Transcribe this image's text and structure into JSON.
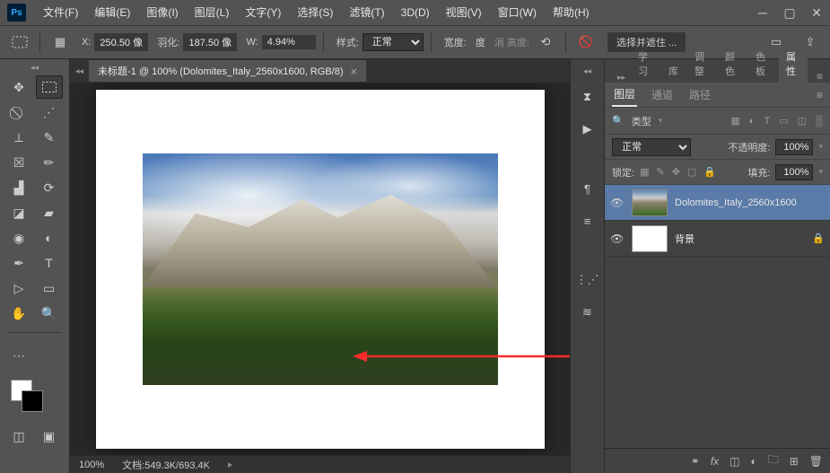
{
  "app": {
    "logo": "Ps"
  },
  "menu": [
    "文件(F)",
    "编辑(E)",
    "图像(I)",
    "图层(L)",
    "文字(Y)",
    "选择(S)",
    "滤镜(T)",
    "3D(D)",
    "视图(V)",
    "窗口(W)",
    "帮助(H)"
  ],
  "options": {
    "x_label": "X:",
    "x_value": "250.50 像",
    "feather_label": "羽化:",
    "feather_value": "187.50 像",
    "w_label": "W:",
    "w_value": "4.94%",
    "style_label": "样式:",
    "style_value": "正常",
    "width_label": "宽度:",
    "height_label": "度",
    "antialias_label": "消 高度:",
    "mask_btn": "选择并遮住 ..."
  },
  "doc": {
    "tab_title": "未标题-1 @ 100% (Dolomites_Italy_2560x1600, RGB/8)",
    "zoom": "100%",
    "status": "文档:549.3K/693.4K"
  },
  "right": {
    "top_tabs": [
      "学习",
      "库",
      "调整",
      "颜色",
      "色板",
      "属性"
    ],
    "sub_tabs": [
      "图层",
      "通道",
      "路径"
    ],
    "filter_label": "类型",
    "blend_mode": "正常",
    "opacity_label": "不透明度:",
    "opacity_value": "100%",
    "lock_label": "锁定:",
    "fill_label": "填充:",
    "fill_value": "100%",
    "layers": [
      {
        "name": "Dolomites_Italy_2560x1600",
        "selected": true,
        "thumb": "img",
        "locked": false
      },
      {
        "name": "背景",
        "selected": false,
        "thumb": "white",
        "locked": true
      }
    ]
  },
  "colors": {
    "panel_bg": "#535353",
    "accent": "#5a7aa8"
  }
}
